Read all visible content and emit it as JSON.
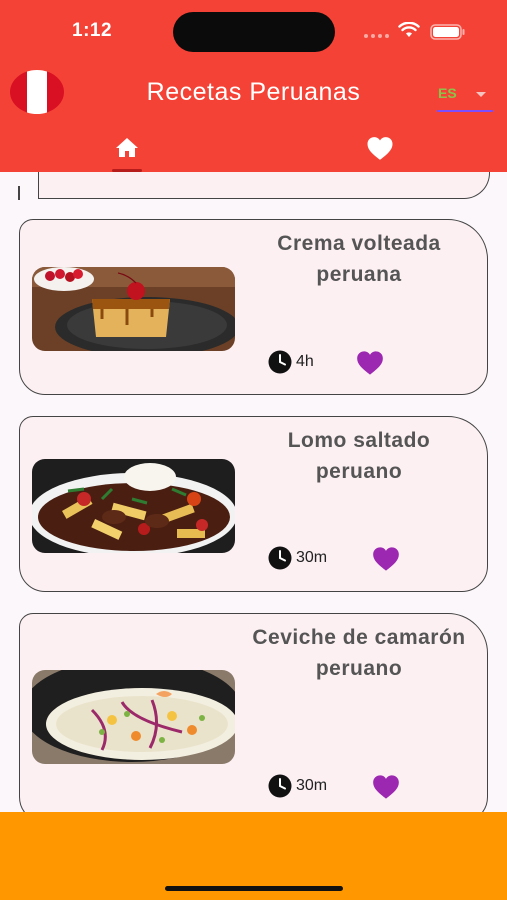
{
  "status_bar": {
    "time": "1:12"
  },
  "app_bar": {
    "title": "Recetas Peruanas",
    "language": "ES"
  },
  "tabs": [
    {
      "name": "home",
      "icon": "home-icon",
      "selected": true
    },
    {
      "name": "favorites",
      "icon": "heart-icon",
      "selected": false
    }
  ],
  "colors": {
    "header": "#f44336",
    "bottom_bar": "#ff9800",
    "card_bg": "#fcf0f3",
    "heart": "#9c27b0",
    "lang_text": "#8bc34a"
  },
  "recipes": [
    {
      "title": "Crema volteada peruana",
      "time": "4h",
      "favorite": true,
      "image": "flan-dessert-photo"
    },
    {
      "title": "Lomo saltado peruano",
      "time": "30m",
      "favorite": true,
      "image": "lomo-saltado-photo"
    },
    {
      "title": "Ceviche de camarón peruano",
      "time": "30m",
      "favorite": true,
      "image": "ceviche-photo"
    }
  ]
}
